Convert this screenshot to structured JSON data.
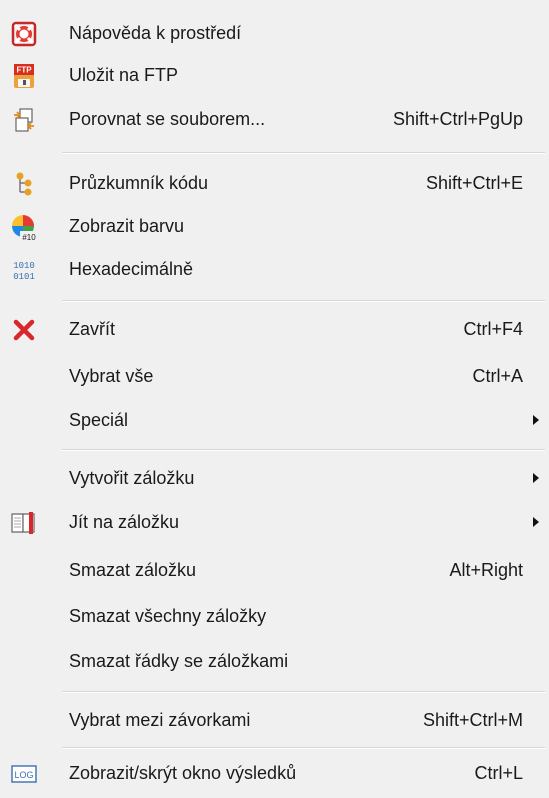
{
  "menu": {
    "items": [
      {
        "label": "Nápověda k prostředí",
        "shortcut": "",
        "icon": "help-lifebuoy-icon"
      },
      {
        "label": "Uložit na FTP",
        "shortcut": "",
        "icon": "ftp-save-icon"
      },
      {
        "label": "Porovnat se souborem...",
        "shortcut": "Shift+Ctrl+PgUp",
        "icon": "compare-files-icon"
      },
      {
        "label": "Průzkumník kódu",
        "shortcut": "Shift+Ctrl+E",
        "icon": "code-explorer-icon"
      },
      {
        "label": "Zobrazit barvu",
        "shortcut": "",
        "icon": "color-wheel-icon",
        "icon_text": "#10"
      },
      {
        "label": "Hexadecimálně",
        "shortcut": "",
        "icon": "binary-icon",
        "icon_text": "1010 0101"
      },
      {
        "label": "Zavřít",
        "shortcut": "Ctrl+F4",
        "icon": "close-x-icon"
      },
      {
        "label": "Vybrat vše",
        "shortcut": "Ctrl+A",
        "icon": ""
      },
      {
        "label": "Speciál",
        "shortcut": "",
        "submenu": true,
        "icon": ""
      },
      {
        "label": "Vytvořit záložku",
        "shortcut": "",
        "submenu": true,
        "icon": ""
      },
      {
        "label": "Jít na záložku",
        "shortcut": "",
        "submenu": true,
        "icon": "bookmark-book-icon"
      },
      {
        "label": "Smazat záložku",
        "shortcut": "Alt+Right",
        "icon": ""
      },
      {
        "label": "Smazat všechny záložky",
        "shortcut": "",
        "icon": ""
      },
      {
        "label": "Smazat řádky se záložkami",
        "shortcut": "",
        "icon": ""
      },
      {
        "label": "Vybrat mezi závorkami",
        "shortcut": "Shift+Ctrl+M",
        "icon": ""
      },
      {
        "label": "Zobrazit/skrýt okno výsledků",
        "shortcut": "Ctrl+L",
        "icon": "log-window-icon",
        "icon_text": "LOG"
      }
    ],
    "ftp_icon_text": "FTP"
  },
  "colors": {
    "background": "#f0f0f0",
    "separator": "#d6d6d6",
    "close_red": "#d9262c",
    "ftp_orange": "#e07b1a",
    "tree_orange": "#e8a020",
    "binary_blue": "#3a6fb0"
  }
}
